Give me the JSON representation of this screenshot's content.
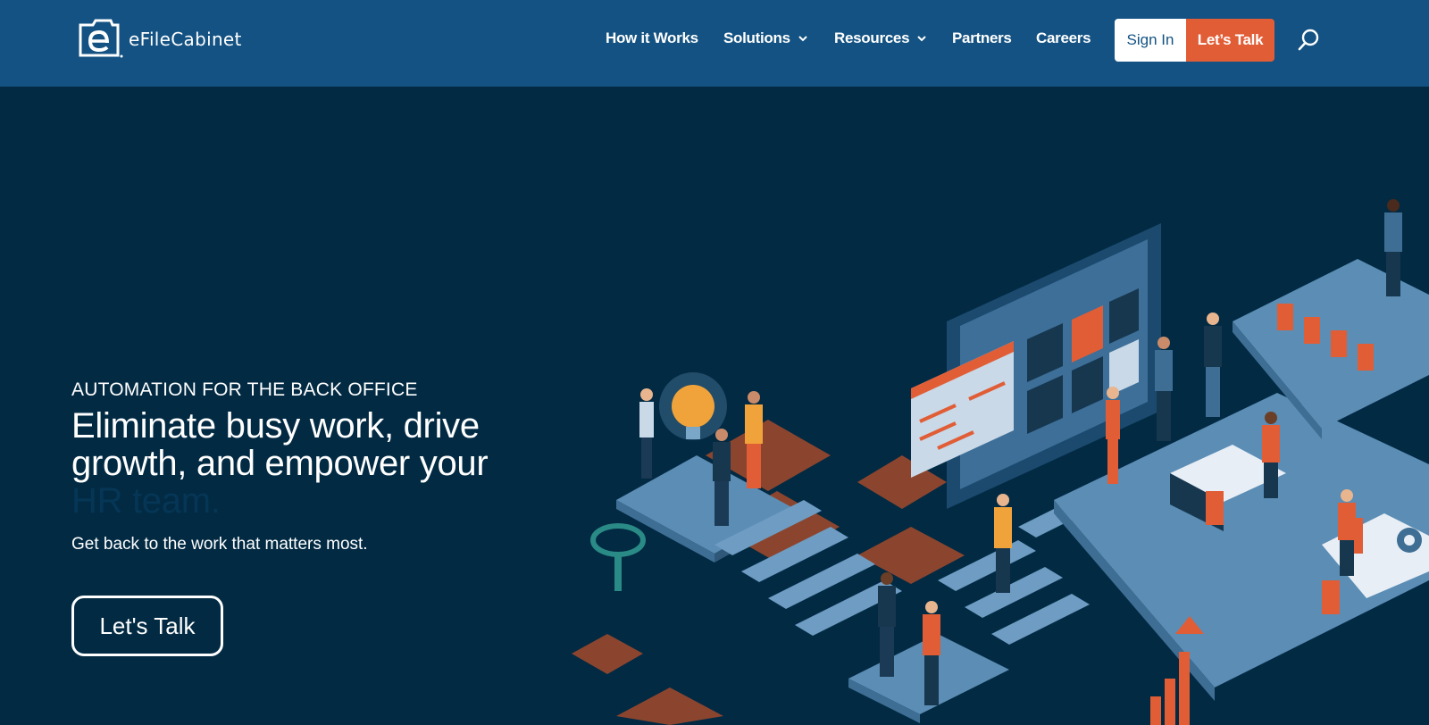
{
  "brand": {
    "name": "eFileCabinet"
  },
  "nav": {
    "items": [
      {
        "label": "How it Works"
      },
      {
        "label": "Solutions",
        "icon": "chevron-down-icon"
      },
      {
        "label": "Resources",
        "icon": "chevron-down-icon"
      },
      {
        "label": "Partners"
      },
      {
        "label": "Careers"
      }
    ],
    "sign_in": "Sign In",
    "lets_talk": "Let’s Talk",
    "search_icon": "search-icon"
  },
  "hero": {
    "eyebrow": "AUTOMATION FOR THE BACK OFFICE",
    "title_line1": "Eliminate busy work, drive",
    "title_line2": "growth, and empower your",
    "title_line3": "HR team.",
    "subtitle": "Get back to the work that matters most.",
    "cta": "Let's Talk"
  },
  "colors": {
    "header_bg": "#135282",
    "page_bg": "#022a43",
    "accent": "#e15d36",
    "illustration_blue": "#5b8db5",
    "illustration_orange": "#e15d36"
  }
}
